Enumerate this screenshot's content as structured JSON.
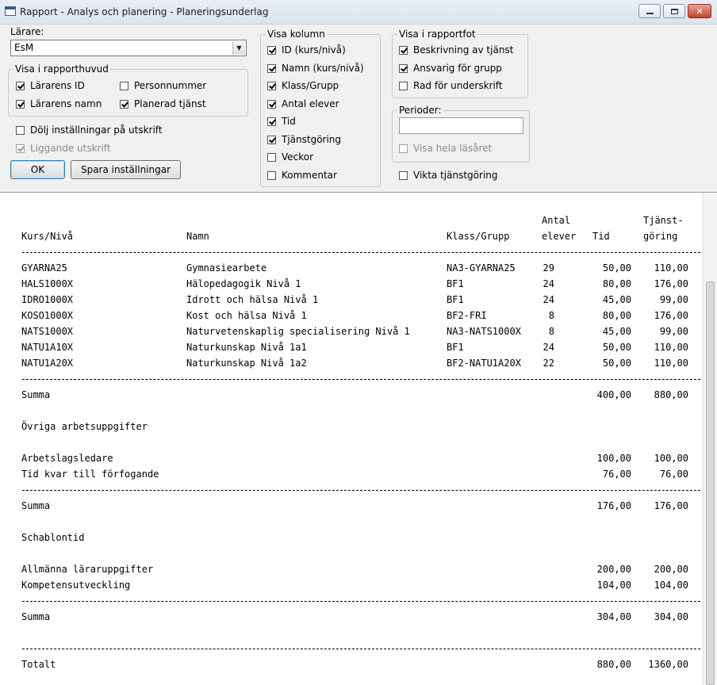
{
  "window": {
    "title": "Rapport - Analys och planering - Planeringsunderlag"
  },
  "teacher": {
    "label": "Lärare:",
    "value": "EsM"
  },
  "header_group": {
    "title": "Visa i rapporthuvud",
    "items": [
      {
        "label": "Lärarens ID",
        "checked": true
      },
      {
        "label": "Personnummer",
        "checked": false
      },
      {
        "label": "Lärarens namn",
        "checked": true
      },
      {
        "label": "Planerad tjänst",
        "checked": true
      }
    ]
  },
  "options": {
    "hide_settings": {
      "label": "Dölj inställningar på utskrift",
      "checked": false
    },
    "landscape": {
      "label": "Liggande utskrift",
      "checked": true,
      "disabled": true
    }
  },
  "buttons": {
    "ok": "OK",
    "save": "Spara inställningar"
  },
  "columns_group": {
    "title": "Visa kolumn",
    "items": [
      {
        "label": "ID (kurs/nivå)",
        "checked": true
      },
      {
        "label": "Namn (kurs/nivå)",
        "checked": true
      },
      {
        "label": "Klass/Grupp",
        "checked": true
      },
      {
        "label": "Antal elever",
        "checked": true
      },
      {
        "label": "Tid",
        "checked": true
      },
      {
        "label": "Tjänstgöring",
        "checked": true
      },
      {
        "label": "Veckor",
        "checked": false
      },
      {
        "label": "Kommentar",
        "checked": false
      }
    ]
  },
  "footer_group": {
    "title": "Visa i rapportfot",
    "items": [
      {
        "label": "Beskrivning av tjänst",
        "checked": true
      },
      {
        "label": "Ansvarig för grupp",
        "checked": true
      },
      {
        "label": "Rad för underskrift",
        "checked": false
      }
    ]
  },
  "periods_group": {
    "title": "Perioder:",
    "input_value": "",
    "whole_year": {
      "label": "Visa hela läsåret",
      "checked": false,
      "disabled": true
    }
  },
  "weight_service": {
    "label": "Vikta tjänstgöring",
    "checked": false
  },
  "report": {
    "headers": {
      "course": "Kurs/Nivå",
      "name": "Namn",
      "group": "Klass/Grupp",
      "count_line1": "Antal",
      "count_line2": "elever",
      "time": "Tid",
      "service_line1": "Tjänst-",
      "service_line2": "göring"
    },
    "rows": [
      {
        "course": "GYARNA25",
        "name": "Gymnasiearbete",
        "group": "NA3-GYARNA25",
        "count": "29",
        "time": "50,00",
        "service": "110,00"
      },
      {
        "course": "HALS1000X",
        "name": "Hälopedagogik Nivå 1",
        "group": "BF1",
        "count": "24",
        "time": "80,00",
        "service": "176,00"
      },
      {
        "course": "IDRO1000X",
        "name": "Idrott och hälsa Nivå 1",
        "group": "BF1",
        "count": "24",
        "time": "45,00",
        "service": "99,00"
      },
      {
        "course": "KOSO1000X",
        "name": "Kost och hälsa Nivå 1",
        "group": "BF2-FRI",
        "count": "8",
        "time": "80,00",
        "service": "176,00"
      },
      {
        "course": "NATS1000X",
        "name": "Naturvetenskaplig specialisering Nivå 1",
        "group": "NA3-NATS1000X",
        "count": "8",
        "time": "45,00",
        "service": "99,00"
      },
      {
        "course": "NATU1A10X",
        "name": "Naturkunskap Nivå 1a1",
        "group": "BF1",
        "count": "24",
        "time": "50,00",
        "service": "110,00"
      },
      {
        "course": "NATU1A20X",
        "name": "Naturkunskap Nivå 1a2",
        "group": "BF2-NATU1A20X",
        "count": "22",
        "time": "50,00",
        "service": "110,00"
      }
    ],
    "sum1": {
      "label": "Summa",
      "time": "400,00",
      "service": "880,00"
    },
    "other_title": "Övriga arbetsuppgifter",
    "other_rows": [
      {
        "label": "Arbetslagsledare",
        "time": "100,00",
        "service": "100,00"
      },
      {
        "label": "Tid kvar till förfogande",
        "time": "76,00",
        "service": "76,00"
      }
    ],
    "sum2": {
      "label": "Summa",
      "time": "176,00",
      "service": "176,00"
    },
    "template_title": "Schablontid",
    "template_rows": [
      {
        "label": "Allmänna läraruppgifter",
        "time": "200,00",
        "service": "200,00"
      },
      {
        "label": "Kompetensutveckling",
        "time": "104,00",
        "service": "104,00"
      }
    ],
    "sum3": {
      "label": "Summa",
      "time": "304,00",
      "service": "304,00"
    },
    "total": {
      "label": "Totalt",
      "time": "880,00",
      "service": "1360,00"
    }
  }
}
